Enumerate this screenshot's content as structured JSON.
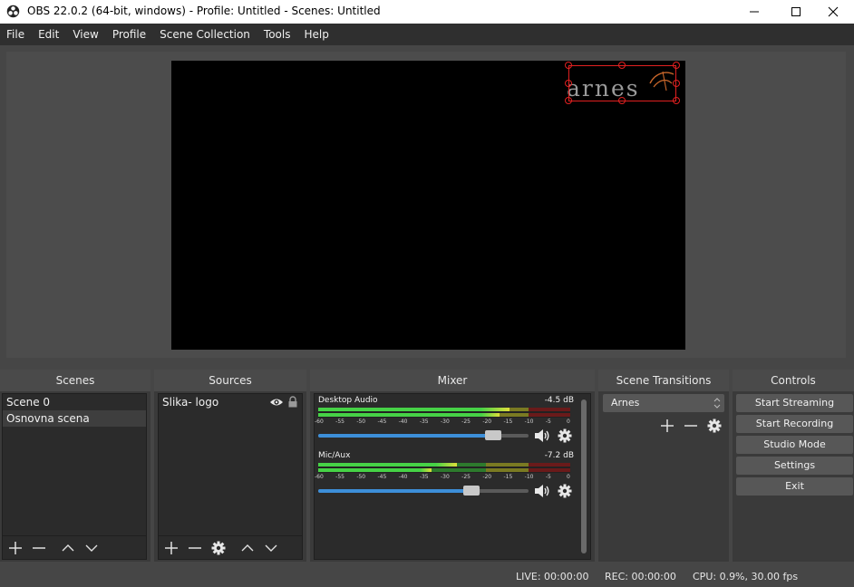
{
  "window": {
    "title": "OBS 22.0.2 (64-bit, windows) - Profile: Untitled - Scenes: Untitled",
    "controls": [
      "minimize-icon",
      "maximize-icon",
      "close-icon"
    ]
  },
  "menu": [
    "File",
    "Edit",
    "View",
    "Profile",
    "Scene Collection",
    "Tools",
    "Help"
  ],
  "preview": {
    "logo_text": "arnes"
  },
  "scenes": {
    "title": "Scenes",
    "items": [
      "Scene 0",
      "Osnovna scena"
    ],
    "selected": "Osnovna scena"
  },
  "sources": {
    "title": "Sources",
    "items": [
      {
        "name": "Slika- logo",
        "visible": true,
        "locked": true
      }
    ]
  },
  "mixer": {
    "title": "Mixer",
    "tick_labels": [
      "-60",
      "-55",
      "-50",
      "-45",
      "-40",
      "-35",
      "-30",
      "-25",
      "-20",
      "-15",
      "-10",
      "-5",
      "0"
    ],
    "channels": [
      {
        "name": "Desktop Audio",
        "db": "-4.5 dB",
        "volume": 0.83
      },
      {
        "name": "Mic/Aux",
        "db": "-7.2 dB",
        "volume": 0.73
      }
    ]
  },
  "transitions": {
    "title": "Scene Transitions",
    "selected": "Arnes"
  },
  "controls": {
    "title": "Controls",
    "buttons": [
      "Start Streaming",
      "Start Recording",
      "Studio Mode",
      "Settings",
      "Exit"
    ]
  },
  "status": {
    "live": "LIVE: 00:00:00",
    "rec": "REC: 00:00:00",
    "cpu": "CPU: 0.9%, 30.00 fps"
  },
  "colors": {
    "accent_blue": "#3d8fd9",
    "meter_green": "#4ec24e",
    "meter_yellow": "#d8d83a",
    "meter_red": "#c03030"
  }
}
